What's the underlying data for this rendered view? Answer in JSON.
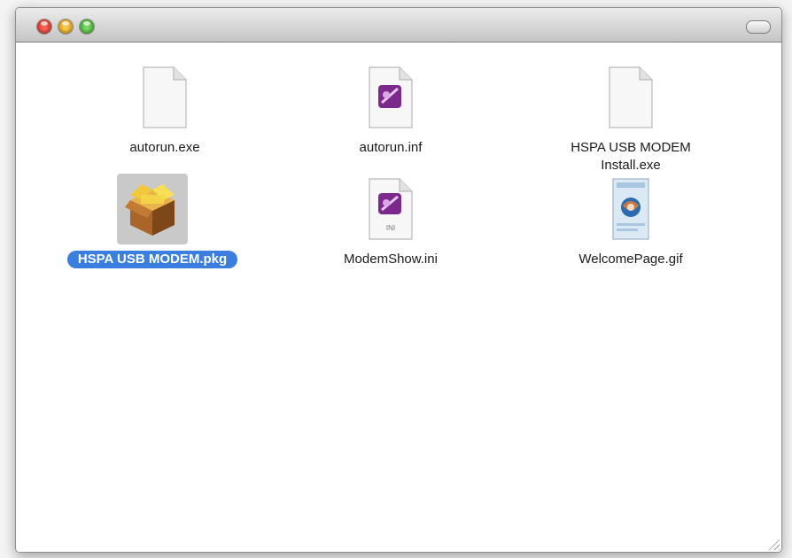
{
  "window": {
    "controls": {
      "close_icon": "close-icon",
      "minimize_icon": "minimize-icon",
      "zoom_icon": "zoom-icon",
      "toolbar_toggle_icon": "toolbar-toggle-icon"
    }
  },
  "files": [
    {
      "name": "autorun.exe",
      "icon": "blank-document-icon"
    },
    {
      "name": "autorun.inf",
      "icon": "inf-document-icon"
    },
    {
      "name": "HSPA USB MODEM\nInstall.exe",
      "icon": "blank-document-icon"
    },
    {
      "name": "HSPA USB MODEM.pkg",
      "icon": "package-box-icon",
      "selected": true
    },
    {
      "name": "ModemShow.ini",
      "icon": "ini-document-icon",
      "badge": "INI"
    },
    {
      "name": "WelcomePage.gif",
      "icon": "gif-image-icon"
    }
  ],
  "colors": {
    "selection": "#3a7ee0",
    "selected_icon_bg": "#c9c9c9"
  }
}
